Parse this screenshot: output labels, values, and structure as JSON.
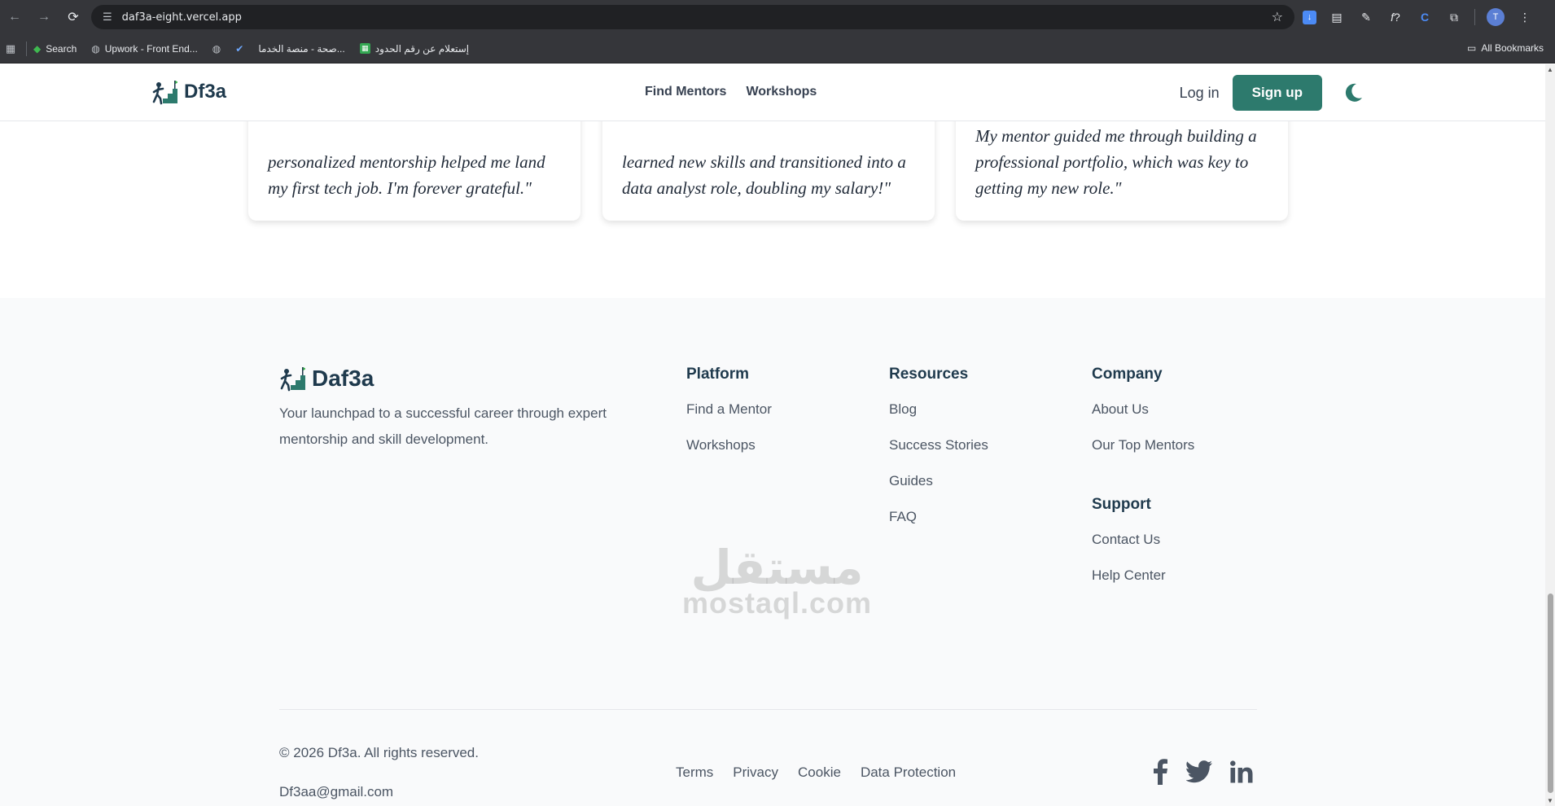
{
  "browser": {
    "url": "daf3a-eight.vercel.app",
    "avatar_letter": "T",
    "bookmarks": [
      {
        "label": "Search",
        "icon": "green-diamond-icon"
      },
      {
        "label": "Upwork - Front End...",
        "icon": "globe-icon"
      },
      {
        "label": "",
        "icon": "globe-icon"
      },
      {
        "label": "",
        "icon": "checkmark-icon"
      },
      {
        "label": "صحة - منصة الخدما...",
        "icon": ""
      },
      {
        "label": "إستعلام عن رقم الحدود",
        "icon": "sheet-icon"
      }
    ],
    "all_bookmarks": "All Bookmarks"
  },
  "header": {
    "logo_text": "Df3a",
    "nav": [
      "Find Mentors",
      "Workshops"
    ],
    "login": "Log in",
    "signup": "Sign up"
  },
  "testimonials": [
    "personalized mentorship helped me land my first tech job. I'm forever grateful.\"",
    "learned new skills and transitioned into a data analyst role, doubling my salary!\"",
    "My mentor guided me through building a professional portfolio, which was key to getting my new role.\""
  ],
  "footer": {
    "logo_text": "Daf3a",
    "tagline": "Your launchpad to a successful career through expert mentorship and skill development.",
    "platform": {
      "title": "Platform",
      "links": [
        "Find a Mentor",
        "Workshops"
      ]
    },
    "resources": {
      "title": "Resources",
      "links": [
        "Blog",
        "Success Stories",
        "Guides",
        "FAQ"
      ]
    },
    "company": {
      "title": "Company",
      "links": [
        "About Us",
        "Our Top Mentors"
      ]
    },
    "support": {
      "title": "Support",
      "links": [
        "Contact Us",
        "Help Center"
      ]
    },
    "copyright": "© 2026 Df3a. All rights reserved.",
    "email": "Df3aa@gmail.com",
    "legal": [
      "Terms",
      "Privacy",
      "Cookie",
      "Data Protection"
    ]
  },
  "watermark": {
    "arabic": "مستقل",
    "latin": "mostaql.com"
  },
  "colors": {
    "brand": "#2d7a6d",
    "heading": "#1f3a4d",
    "footer_bg": "#f9fafb"
  }
}
